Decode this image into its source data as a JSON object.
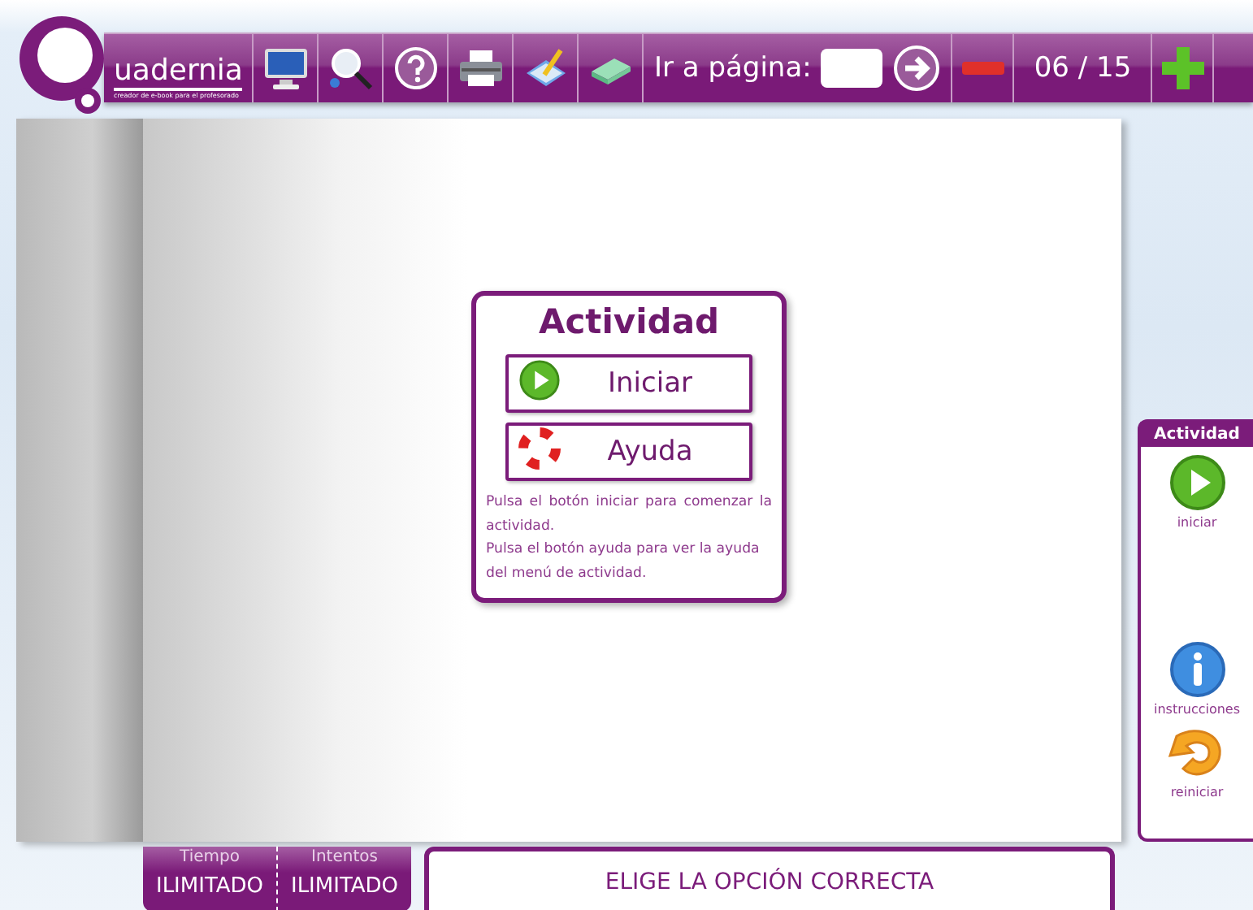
{
  "toolbar": {
    "logo_text": "uadernia",
    "logo_tagline": "creador de e-book para el profesorado",
    "tools": [
      {
        "kind": "monitor"
      },
      {
        "kind": "zoom"
      },
      {
        "kind": "help"
      },
      {
        "kind": "print"
      },
      {
        "kind": "notes"
      },
      {
        "kind": "eraser"
      }
    ],
    "goto_label": "Ir a página:",
    "page_counter": "06 / 15"
  },
  "activity_card": {
    "title": "Actividad",
    "buttons": [
      {
        "kind": "start",
        "label": "Iniciar"
      },
      {
        "kind": "help",
        "label": "Ayuda"
      }
    ],
    "instructions": "Pulsa el botón iniciar para comenzar la actividad.",
    "instructions_2": "Pulsa el botón ayuda para ver la ayuda del menú de actividad."
  },
  "side_panel": {
    "title": "Actividad",
    "items": [
      {
        "kind": "start",
        "label": "iniciar"
      },
      {
        "kind": "info",
        "label": "instrucciones"
      },
      {
        "kind": "restart",
        "label": "reiniciar"
      }
    ]
  },
  "status": {
    "columns": [
      {
        "heading": "Tiempo",
        "value": "ILIMITADO"
      },
      {
        "heading": "Intentos",
        "value": "ILIMITADO"
      }
    ],
    "message": "ELIGE LA OPCIÓN CORRECTA"
  }
}
